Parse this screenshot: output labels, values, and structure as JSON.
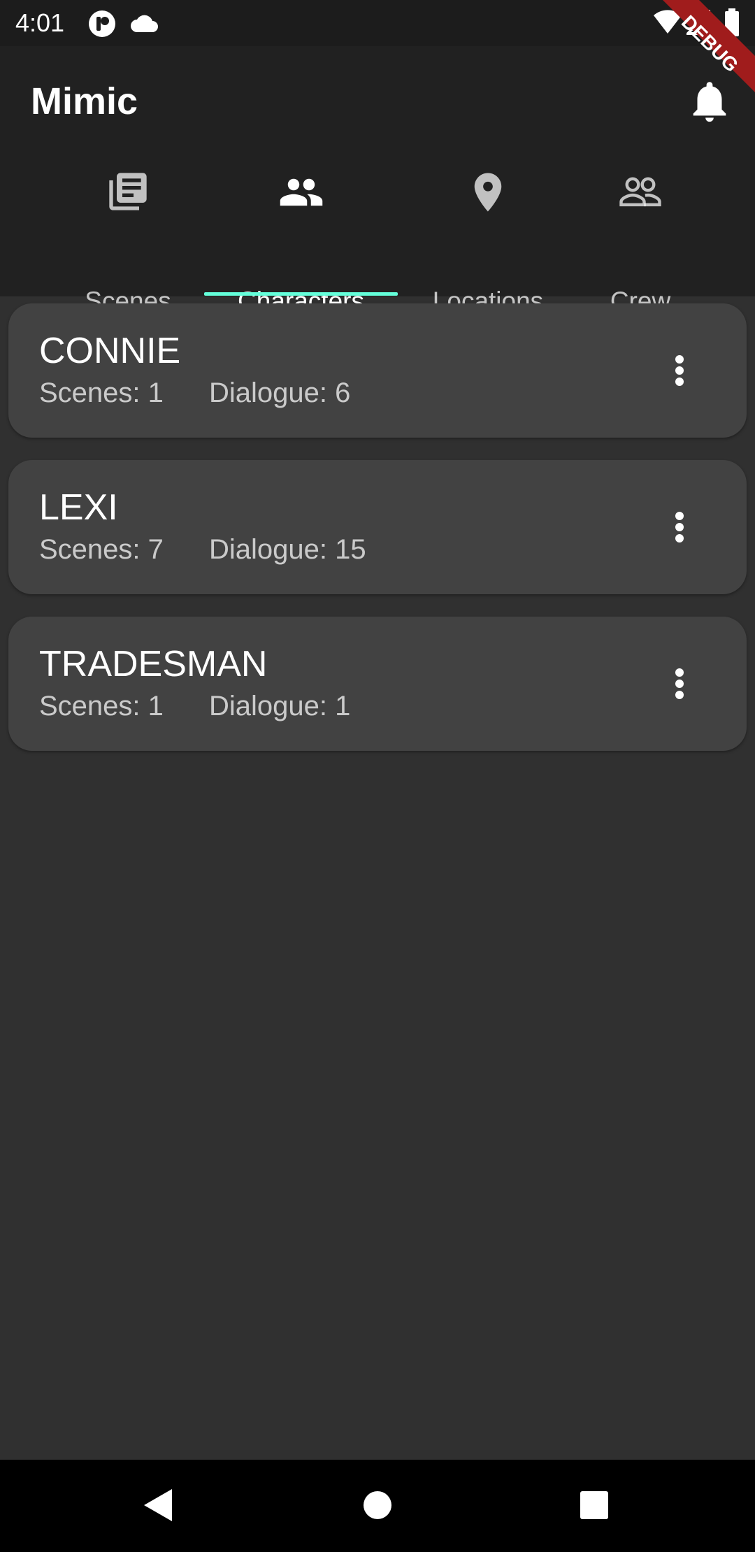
{
  "status_bar": {
    "time": "4:01"
  },
  "app_bar": {
    "title": "Mimic",
    "debug_banner": "DEBUG"
  },
  "tabs": [
    {
      "label": "Scenes",
      "icon": "library-books-icon"
    },
    {
      "label": "Characters",
      "icon": "people-icon",
      "active": true
    },
    {
      "label": "Locations",
      "icon": "location-pin-icon"
    },
    {
      "label": "Crew",
      "icon": "people-outline-icon"
    }
  ],
  "characters": [
    {
      "name": "CONNIE",
      "scenes": "Scenes: 1",
      "dialogue": "Dialogue: 6"
    },
    {
      "name": "LEXI",
      "scenes": "Scenes: 7",
      "dialogue": "Dialogue: 15"
    },
    {
      "name": "TRADESMAN",
      "scenes": "Scenes: 1",
      "dialogue": "Dialogue: 1"
    }
  ],
  "colors": {
    "accent": "#64ffda",
    "app_bar": "#212121",
    "background": "#303030",
    "card": "#424242",
    "debug_banner": "#a01c1c"
  }
}
